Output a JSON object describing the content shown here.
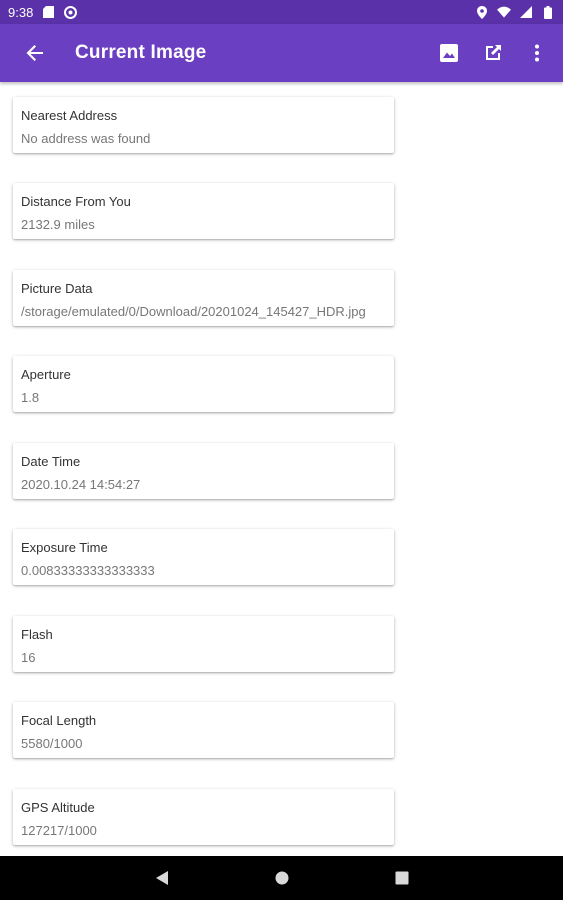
{
  "status_bar": {
    "time": "9:38"
  },
  "app_bar": {
    "title": "Current Image"
  },
  "fields": [
    {
      "label": "Nearest Address",
      "value": "No address was found"
    },
    {
      "label": "Distance From You",
      "value": "2132.9 miles"
    },
    {
      "label": "Picture Data",
      "value": "/storage/emulated/0/Download/20201024_145427_HDR.jpg"
    },
    {
      "label": "Aperture",
      "value": "1.8"
    },
    {
      "label": "Date Time",
      "value": "2020.10.24 14:54:27"
    },
    {
      "label": "Exposure Time",
      "value": "0.00833333333333333"
    },
    {
      "label": "Flash",
      "value": "16"
    },
    {
      "label": "Focal Length",
      "value": "5580/1000"
    },
    {
      "label": "GPS Altitude",
      "value": "127217/1000"
    }
  ],
  "colors": {
    "status_bar": "#5a31a8",
    "app_bar": "#6b3fc1",
    "nav_bar": "#000000"
  },
  "icons": {
    "status_left": [
      "sd-card-icon",
      "sync-icon"
    ],
    "status_right": [
      "location-icon",
      "wifi-icon",
      "signal-icon",
      "battery-icon"
    ],
    "app_bar": [
      "back-arrow-icon",
      "image-icon",
      "open-external-icon",
      "more-vert-icon"
    ],
    "nav": [
      "nav-back-icon",
      "nav-home-icon",
      "nav-recents-icon"
    ]
  }
}
